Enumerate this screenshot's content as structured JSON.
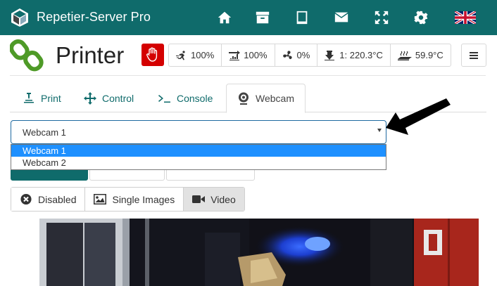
{
  "app": {
    "title": "Repetier-Server Pro"
  },
  "nav_icons": [
    "home-icon",
    "archive-icon",
    "tablet-icon",
    "envelope-icon",
    "fullscreen-icon",
    "gear-icon",
    "uk-flag-icon"
  ],
  "printer": {
    "title": "Printer",
    "status": {
      "speed": "100%",
      "flow": "100%",
      "fan": "0%",
      "extruder": "1: 220.3°C",
      "bed": "59.9°C"
    }
  },
  "tabs": [
    {
      "label": "Print",
      "icon": "print-icon"
    },
    {
      "label": "Control",
      "icon": "move-icon"
    },
    {
      "label": "Console",
      "icon": "terminal-icon"
    },
    {
      "label": "Webcam",
      "icon": "webcam-icon",
      "active": true
    }
  ],
  "webcam_select": {
    "value": "Webcam 1",
    "options": [
      "Webcam 1",
      "Webcam 2"
    ]
  },
  "modes": [
    {
      "label": "Disabled",
      "icon": "disabled-icon"
    },
    {
      "label": "Single Images",
      "icon": "image-icon"
    },
    {
      "label": "Video",
      "icon": "video-icon",
      "active": true
    }
  ],
  "colors": {
    "brand": "#0f6b6b",
    "stop": "#d40000",
    "selected_option": "#1e90ff"
  }
}
